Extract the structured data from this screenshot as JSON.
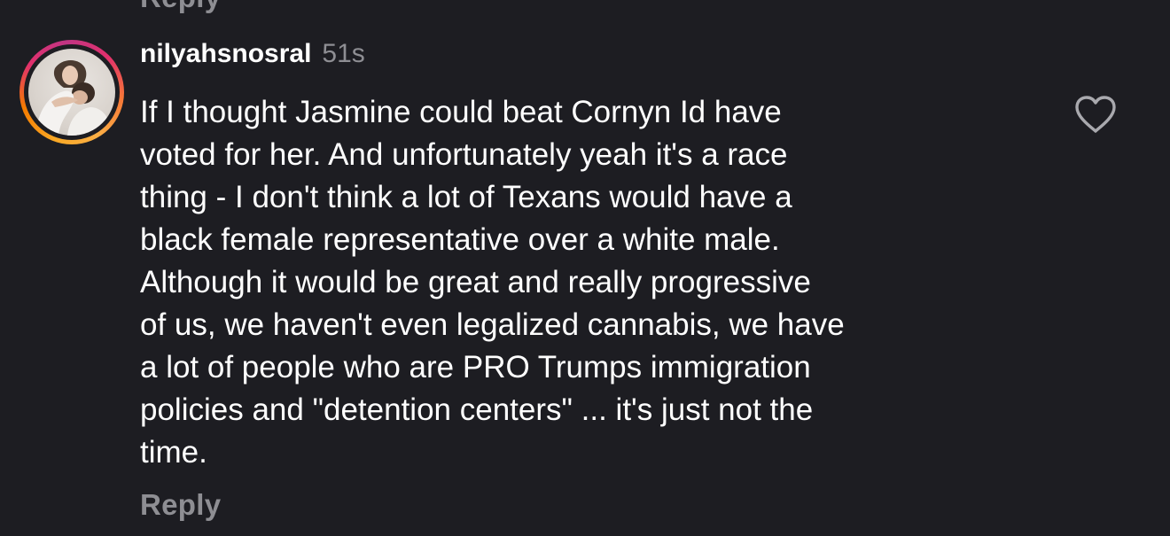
{
  "comment": {
    "username": "nilyahsnosral",
    "timestamp": "51s",
    "lines": [
      "If I thought Jasmine could beat Cornyn Id have",
      "voted for her. And unfortunately yeah it's a race",
      "thing - I don't think a lot of Texans would have a",
      "black female representative over a white male.",
      "Although it would be great and really progressive",
      "of us, we haven't even legalized cannabis, we have",
      "a lot of people who are PRO Trumps immigration",
      "policies and \"detention centers\" ... it's just not the",
      "time."
    ],
    "reply_label": "Reply",
    "like_icon": "heart-outline-icon"
  },
  "previous_comment": {
    "reply_label": "Reply"
  },
  "colors": {
    "background": "#1d1d22",
    "text": "#ffffff",
    "muted": "#8e8e93",
    "story_ring_start": "#f9a825",
    "story_ring_end": "#c13584"
  }
}
